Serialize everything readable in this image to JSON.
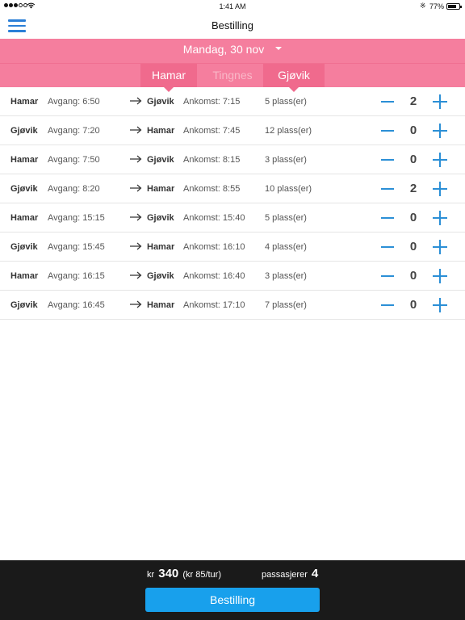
{
  "status_bar": {
    "time": "1:41 AM",
    "battery_percent": "77%",
    "battery_level": 0.77,
    "icons": [
      "signal-dots-icon",
      "wifi-icon",
      "bluetooth-icon",
      "battery-icon"
    ]
  },
  "nav": {
    "title": "Bestilling",
    "menu_icon": "hamburger-menu-icon"
  },
  "date_selector": {
    "label": "Mandag, 30 nov",
    "icon": "caret-down-icon"
  },
  "tabs": [
    {
      "label": "Hamar",
      "active": true
    },
    {
      "label": "Tingnes",
      "active": false
    },
    {
      "label": "Gjøvik",
      "active": true
    }
  ],
  "trips": [
    {
      "from": "Hamar",
      "departure": "Avgang: 6:50",
      "to": "Gjøvik",
      "arrival": "Ankomst: 7:15",
      "seats": "5 plass(er)",
      "count": "2"
    },
    {
      "from": "Gjøvik",
      "departure": "Avgang: 7:20",
      "to": "Hamar",
      "arrival": "Ankomst: 7:45",
      "seats": "12 plass(er)",
      "count": "0"
    },
    {
      "from": "Hamar",
      "departure": "Avgang: 7:50",
      "to": "Gjøvik",
      "arrival": "Ankomst: 8:15",
      "seats": "3 plass(er)",
      "count": "0"
    },
    {
      "from": "Gjøvik",
      "departure": "Avgang: 8:20",
      "to": "Hamar",
      "arrival": "Ankomst: 8:55",
      "seats": "10 plass(er)",
      "count": "2"
    },
    {
      "from": "Hamar",
      "departure": "Avgang: 15:15",
      "to": "Gjøvik",
      "arrival": "Ankomst: 15:40",
      "seats": "5 plass(er)",
      "count": "0"
    },
    {
      "from": "Gjøvik",
      "departure": "Avgang: 15:45",
      "to": "Hamar",
      "arrival": "Ankomst: 16:10",
      "seats": "4 plass(er)",
      "count": "0"
    },
    {
      "from": "Hamar",
      "departure": "Avgang: 16:15",
      "to": "Gjøvik",
      "arrival": "Ankomst: 16:40",
      "seats": "3 plass(er)",
      "count": "0"
    },
    {
      "from": "Gjøvik",
      "departure": "Avgang: 16:45",
      "to": "Hamar",
      "arrival": "Ankomst: 17:10",
      "seats": "7 plass(er)",
      "count": "0"
    }
  ],
  "footer": {
    "currency": "kr",
    "total": "340",
    "per_trip": "(kr 85/tur)",
    "passengers_label": "passasjerer",
    "passengers_count": "4",
    "order_button": "Bestilling"
  },
  "colors": {
    "accent_pink": "#f57e9e",
    "accent_blue": "#2b8fd6",
    "button_blue": "#18a0ec",
    "footer_bg": "#1a1a1a"
  }
}
